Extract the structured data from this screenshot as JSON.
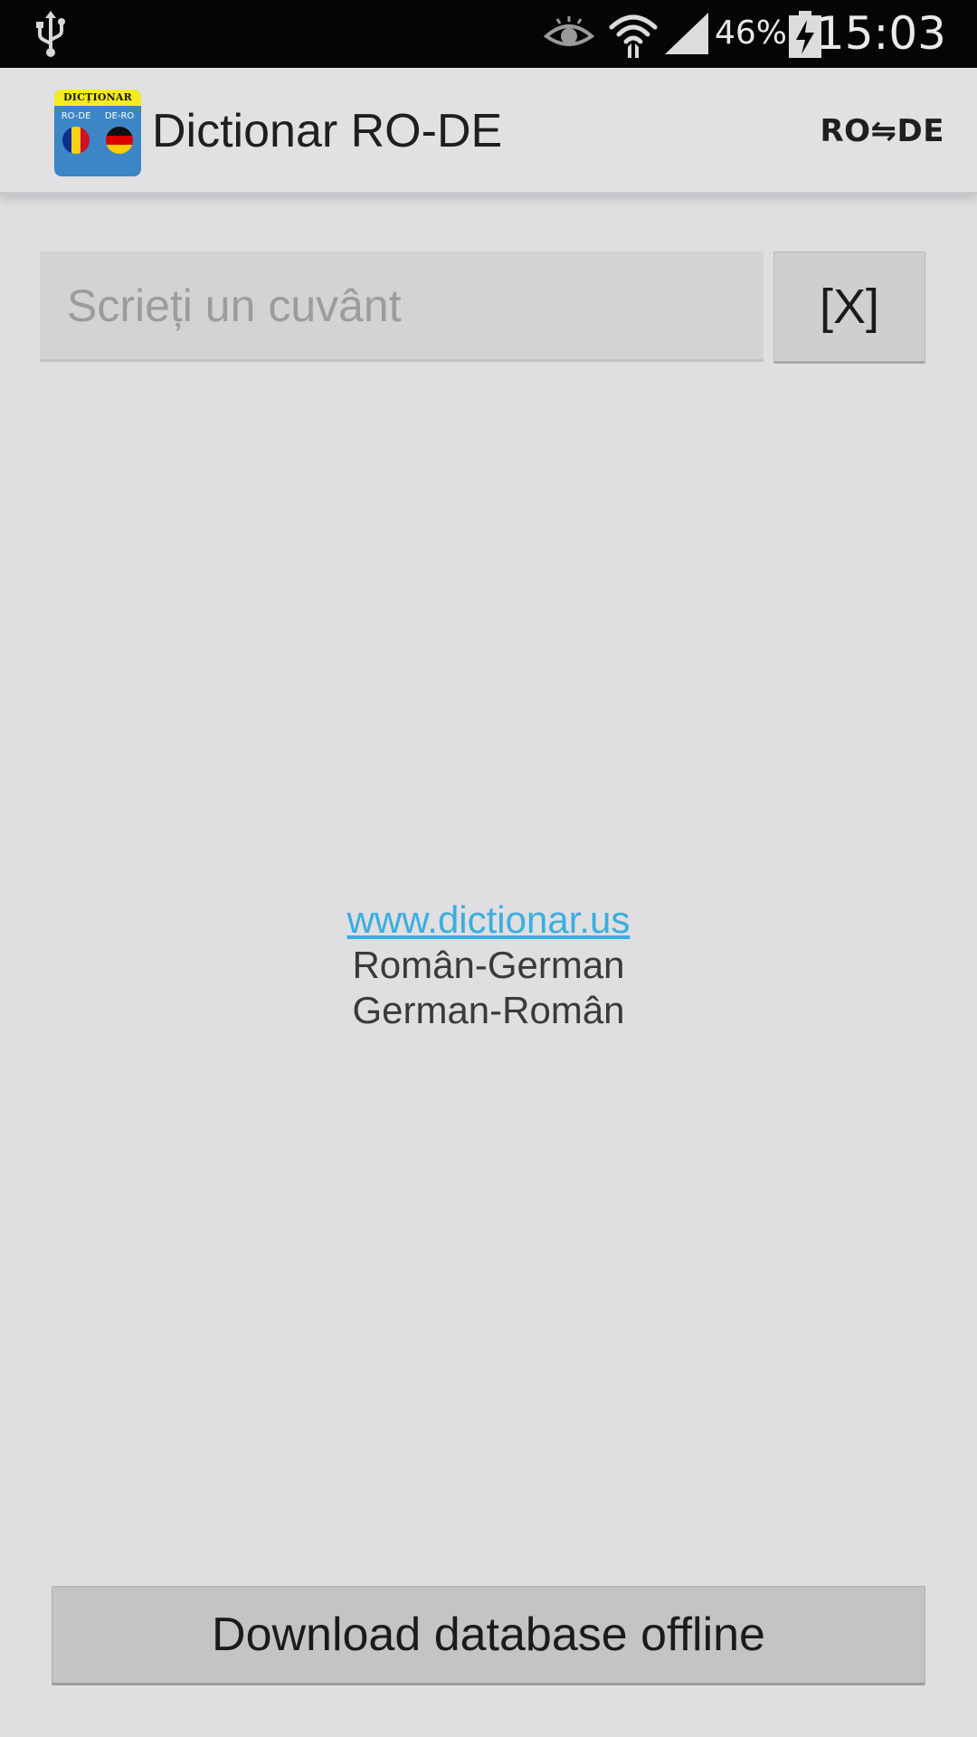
{
  "status_bar": {
    "battery_percent": "46%",
    "time": "15:03",
    "icons": [
      "usb-icon",
      "eye-icon",
      "wifi-icon",
      "signal-icon",
      "battery-charging-icon"
    ]
  },
  "action_bar": {
    "title": "Dictionar RO-DE",
    "logo": {
      "top_text": "DICȚIONAR",
      "left_label": "RO-DE",
      "right_label": "DE-RO"
    },
    "lang_toggle": "RO⇋DE"
  },
  "search": {
    "placeholder": "Scrieți un cuvânt",
    "value": "",
    "clear_label": "[X]"
  },
  "info": {
    "link": "www.dictionar.us",
    "line1": "Român-German",
    "line2": "German-Român"
  },
  "footer": {
    "download_label": "Download database offline"
  },
  "colors": {
    "background": "#dfdee1",
    "status_bar": "#050505",
    "link": "#3aaee0"
  }
}
